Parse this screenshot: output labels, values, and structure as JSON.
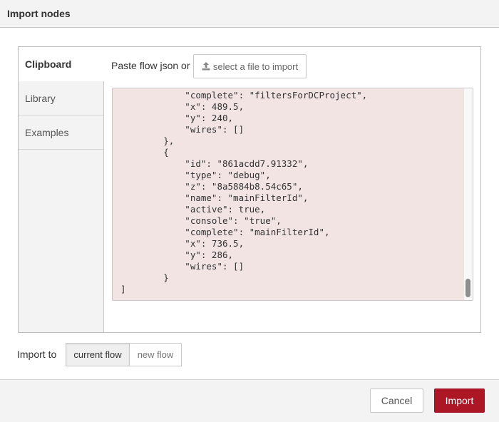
{
  "dialog": {
    "title": "Import nodes"
  },
  "tabs": [
    {
      "label": "Clipboard",
      "active": true
    },
    {
      "label": "Library",
      "active": false
    },
    {
      "label": "Examples",
      "active": false
    }
  ],
  "clipboard": {
    "paste_label": "Paste flow json or",
    "file_button_label": "select a file to import",
    "file_button_icon": "upload-icon",
    "json_text": "            \"complete\": \"filtersForDCProject\",\n            \"x\": 489.5,\n            \"y\": 240,\n            \"wires\": []\n        },\n        {\n            \"id\": \"861acdd7.91332\",\n            \"type\": \"debug\",\n            \"z\": \"8a5884b8.54c65\",\n            \"name\": \"mainFilterId\",\n            \"active\": true,\n            \"console\": \"true\",\n            \"complete\": \"mainFilterId\",\n            \"x\": 736.5,\n            \"y\": 286,\n            \"wires\": []\n        }\n]"
  },
  "import_to": {
    "label": "Import to",
    "options": [
      "current flow",
      "new flow"
    ],
    "selected": "current flow"
  },
  "footer": {
    "cancel_label": "Cancel",
    "import_label": "Import"
  },
  "colors": {
    "editor_background": "#f3e4e4",
    "primary_button": "#ad1625"
  }
}
